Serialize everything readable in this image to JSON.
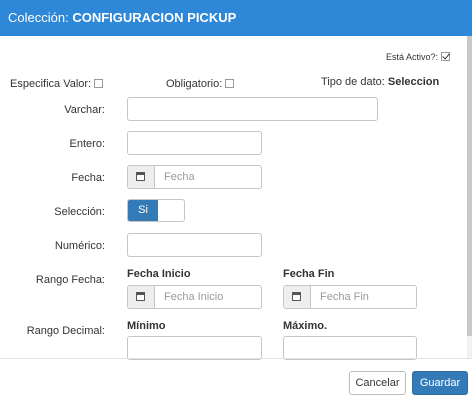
{
  "header": {
    "prefix": "Colección: ",
    "name": "CONFIGURACION PICKUP"
  },
  "flags": {
    "active_label": "Está Activo?:",
    "specific_label": "Especifica Valor:",
    "required_label": "Obligatorio:",
    "data_type_label": "Tipo de dato:",
    "data_type_value": "Seleccion"
  },
  "fields": {
    "varchar": {
      "label": "Varchar:",
      "value": ""
    },
    "entero": {
      "label": "Entero:",
      "value": ""
    },
    "fecha": {
      "label": "Fecha:",
      "placeholder": "Fecha"
    },
    "seleccion": {
      "label": "Selección:",
      "toggle_on": "Si"
    },
    "numerico": {
      "label": "Numérico:",
      "value": ""
    },
    "rango_fecha": {
      "label": "Rango Fecha:",
      "start_header": "Fecha Inicio",
      "start_placeholder": "Fecha Inicio",
      "end_header": "Fecha Fin",
      "end_placeholder": "Fecha Fin"
    },
    "rango_decimal": {
      "label": "Rango Decimal:",
      "min_header": "Mínimo",
      "max_header": "Máximo."
    }
  },
  "footer": {
    "cancel": "Cancelar",
    "save": "Guardar"
  }
}
